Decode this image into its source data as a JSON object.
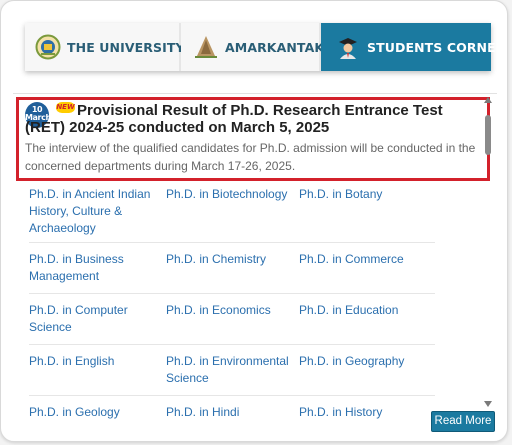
{
  "tabs": [
    {
      "label": "THE UNIVERSITY",
      "icon": "university-emblem-icon"
    },
    {
      "label": "AMARKANTAK",
      "icon": "temple-icon"
    },
    {
      "label": "STUDENTS CORNER",
      "icon": "graduate-student-icon",
      "active": true
    }
  ],
  "notice": {
    "date_day": "10",
    "date_month": "March",
    "new_label": "NEW",
    "title": "Provisional Result of Ph.D. Research Entrance Test (RET) 2024-25 conducted on March 5, 2025",
    "description": "The interview of the qualified candidates for Ph.D. admission will be conducted in the concerned departments during March 17-26, 2025."
  },
  "programs": [
    [
      "Ph.D. in Ancient Indian History, Culture & Archaeology",
      "Ph.D. in Biotechnology",
      "Ph.D. in Botany"
    ],
    [
      "Ph.D. in Business Management",
      "Ph.D. in Chemistry",
      "Ph.D. in Commerce"
    ],
    [
      "Ph.D. in Computer Science",
      "Ph.D. in Economics",
      "Ph.D. in Education"
    ],
    [
      "Ph.D. in English",
      "Ph.D. in Environmental Science",
      "Ph.D. in Geography"
    ],
    [
      "Ph.D. in Geology",
      "Ph.D. in Hindi",
      "Ph.D. in History"
    ]
  ],
  "read_more_label": "Read More",
  "colors": {
    "active_tab": "#1b7aa0",
    "tab_text": "#2a5e76",
    "highlight_border": "#d3212b",
    "link": "#2b6fae"
  }
}
